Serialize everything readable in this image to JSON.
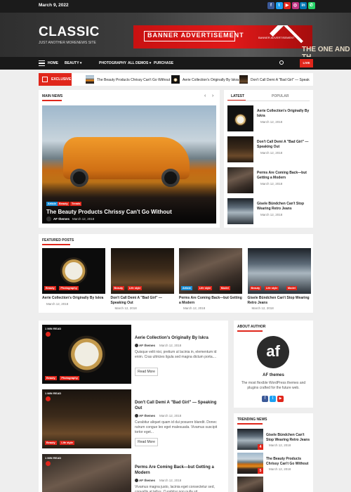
{
  "topbar": {
    "date": "March 9, 2022",
    "social": [
      {
        "icon": "facebook-icon",
        "glyph": "f",
        "color": "#3b5998"
      },
      {
        "icon": "twitter-icon",
        "glyph": "t",
        "color": "#1da1f2"
      },
      {
        "icon": "youtube-icon",
        "glyph": "▶",
        "color": "#e0261b"
      },
      {
        "icon": "instagram-icon",
        "glyph": "◎",
        "color": "#c13584"
      },
      {
        "icon": "linkedin-icon",
        "glyph": "in",
        "color": "#0077b5"
      },
      {
        "icon": "whatsapp-icon",
        "glyph": "✆",
        "color": "#25d366"
      }
    ]
  },
  "header": {
    "logo": "CLASSIC",
    "tagline": "JUST ANOTHER MORENEWS SITE",
    "banner_title": "BANNER ADVERTISEMENT",
    "banner_sub": "BANNER ADVERTISEMENT",
    "banner_overlay": "THE ONE AND TH"
  },
  "nav": {
    "items": [
      "HOME",
      "BEAUTY ▾",
      "PHOTOGRAPHY",
      "ALL DEMOS ▾",
      "PURCHASE"
    ],
    "new_tag": "",
    "live": "LIVE"
  },
  "ticker": {
    "label": "EXCLUSIVE",
    "items": [
      "The Beauty Products Chrissy Can't Go Without",
      "Aerie Collection's Originally By Iskra",
      "Don't Call Demi A \"Bad Girl\" — Speak"
    ]
  },
  "main_news": {
    "title": "MAIN NEWS",
    "tags": [
      "Article",
      "Beauty",
      "Trends"
    ],
    "headline": "The Beauty Products Chrissy Can't Go Without",
    "author": "AF themes",
    "date": "March 12, 2018"
  },
  "sidebar_tabs": {
    "latest": "LATEST",
    "popular": "POPULAR",
    "items": [
      {
        "title": "Aerie Collection's Originally By Iskra",
        "date": "March 12, 2018"
      },
      {
        "title": "Don't Call Demi A \"Bad Girl\" — Speaking Out",
        "date": "March 12, 2018"
      },
      {
        "title": "Perms Are Coming Back—but Getting a Modern",
        "date": "March 12, 2018"
      },
      {
        "title": "Gisele Bündchen Can't Stop Wearing Retro Jeans",
        "date": "March 12, 2018"
      }
    ]
  },
  "featured": {
    "title": "FEATURED POSTS",
    "posts": [
      {
        "title": "Aerie Collection's Originally By Iskra",
        "date": "March 12, 2018",
        "tags": [
          "Beauty",
          "Photography"
        ]
      },
      {
        "title": "Don't Call Demi A \"Bad Girl\" — Speaking Out",
        "date": "March 12, 2018",
        "tags": [
          "Beauty",
          "Life style"
        ]
      },
      {
        "title": "Perms Are Coming Back—but Getting a Modern",
        "date": "March 12, 2018",
        "tags": [
          "Article",
          "Life style",
          "Model"
        ]
      },
      {
        "title": "Gisele Bündchen Can't Stop Wearing Retro Jeans",
        "date": "March 12, 2018",
        "tags": [
          "Beauty",
          "Life style",
          "Model"
        ]
      }
    ]
  },
  "list": {
    "posts": [
      {
        "read": "1 MIN READ",
        "title": "Aerie Collection's Originally By Iskra",
        "author": "AF themes",
        "date": "March 12, 2018",
        "excerpt": "Quisque velit nisi, pretium ut lacinia in, elementum id enim. Cras ultricies ligula sed magna dictum porta....",
        "button": "Read More",
        "tags": [
          "Beauty",
          "Photography"
        ]
      },
      {
        "read": "1 MIN READ",
        "title": "Don't Call Demi A \"Bad Girl\" — Speaking Out",
        "author": "AF themes",
        "date": "March 12, 2018",
        "excerpt": "Curabitur aliquet quam id dui posuere blandit. Donec rutrum congue leo eget malesuada. Vivamus suscipit tortor eget...",
        "button": "Read More",
        "tags": [
          "Beauty",
          "Life style"
        ]
      },
      {
        "read": "1 MIN READ",
        "title": "Perms Are Coming Back—but Getting a Modern",
        "author": "AF themes",
        "date": "March 12, 2018",
        "excerpt": "Vivamus magna justo, lacinia eget consectetur sed, convallis at tellus. Curabitur non nulla sit"
      }
    ]
  },
  "about": {
    "title": "ABOUT AUTHOR",
    "logo": "af",
    "name": "AF themes",
    "desc": "The most flexible WordPress themes and plugins crafted for the future web."
  },
  "trending": {
    "title": "TRENDING NEWS",
    "items": [
      {
        "rank": "4",
        "title": "Gisele Bündchen Can't Stop Wearing Retro Jeans",
        "date": "March 12, 2018"
      },
      {
        "rank": "5",
        "title": "The Beauty Products Chrissy Can't Go Without",
        "date": "March 12, 2018"
      },
      {
        "rank": "6",
        "title": "",
        "date": ""
      }
    ]
  }
}
